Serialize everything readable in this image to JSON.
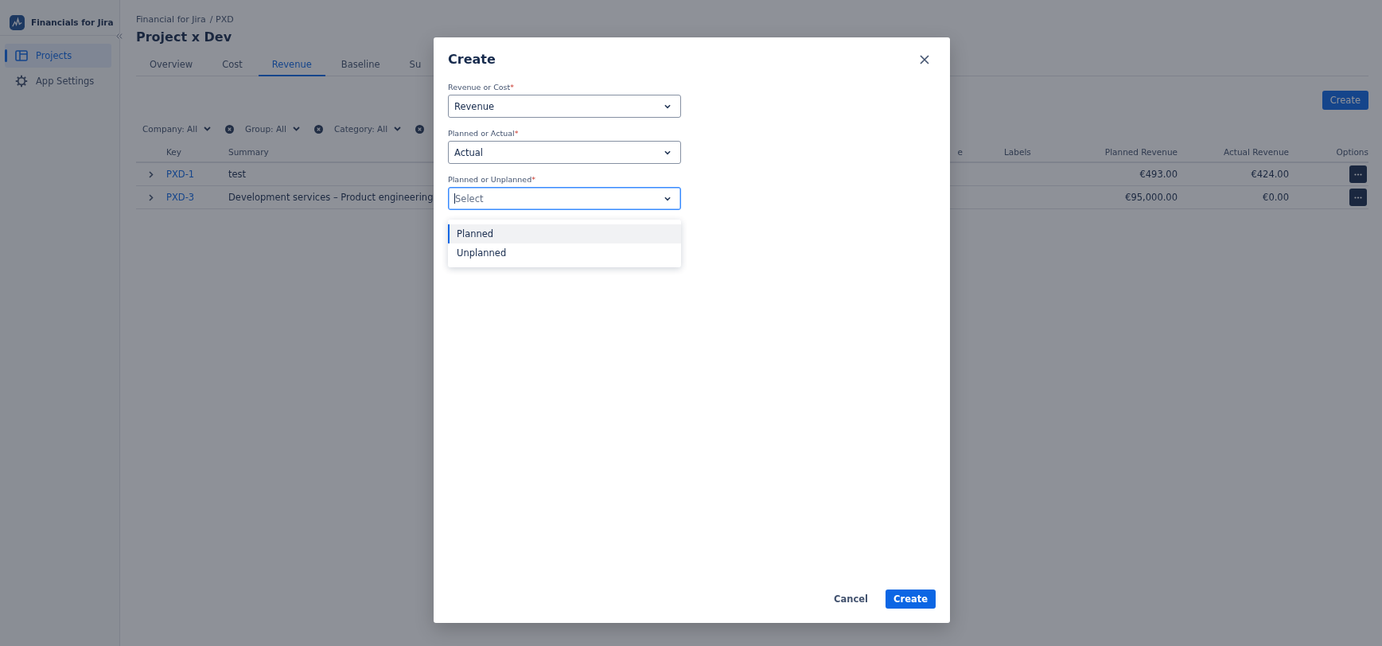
{
  "sidebar": {
    "app_name": "Financials for Jira",
    "items": [
      {
        "label": "Projects",
        "selected": true
      },
      {
        "label": "App Settings",
        "selected": false
      }
    ]
  },
  "breadcrumb": [
    "Financial for Jira",
    "/ PXD"
  ],
  "page_title": "Project x Dev",
  "tabs": [
    {
      "label": "Overview",
      "selected": false
    },
    {
      "label": "Cost",
      "selected": false
    },
    {
      "label": "Revenue",
      "selected": true
    },
    {
      "label": "Baseline",
      "selected": false
    },
    {
      "label": "Su",
      "selected": false
    }
  ],
  "create_button": "Create",
  "filters": [
    {
      "label": "Company: All"
    },
    {
      "label": "Group: All"
    },
    {
      "label": "Category: All"
    }
  ],
  "table": {
    "columns": [
      "Key",
      "Summary",
      "e",
      "Labels",
      "Planned Revenue",
      "Actual Revenue",
      "Options"
    ],
    "rows": [
      {
        "key": "PXD-1",
        "summary": "test",
        "planned_revenue": "€493.00",
        "actual_revenue": "€424.00"
      },
      {
        "key": "PXD-3",
        "summary": "Development services – Product engineering",
        "planned_revenue": "€95,000.00",
        "actual_revenue": "€0.00"
      }
    ]
  },
  "dialog": {
    "title": "Create",
    "fields": [
      {
        "label": "Revenue or Cost",
        "required_mark": "*",
        "value": "Revenue",
        "focused": false
      },
      {
        "label": "Planned or Actual",
        "required_mark": "*",
        "value": "Actual",
        "focused": false
      },
      {
        "label": "Planned or Unplanned",
        "required_mark": "*",
        "placeholder": "Select",
        "focused": true,
        "options": [
          {
            "label": "Planned",
            "selected": true
          },
          {
            "label": "Unplanned",
            "selected": false
          }
        ]
      }
    ],
    "buttons": [
      {
        "label": "Cancel",
        "kind": "subtle"
      },
      {
        "label": "Create",
        "kind": "primary"
      }
    ]
  }
}
